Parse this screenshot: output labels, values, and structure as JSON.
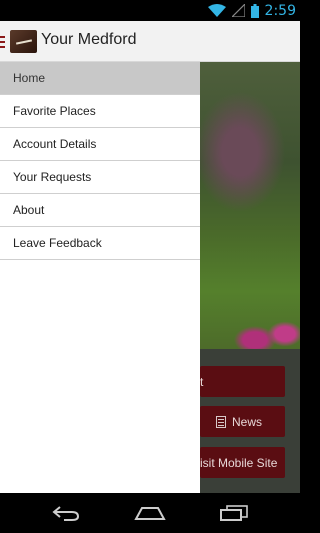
{
  "status_bar": {
    "time": "2:59"
  },
  "app_bar": {
    "title": "Your Medford"
  },
  "drawer": {
    "items": [
      {
        "label": "Home",
        "active": true
      },
      {
        "label": "Favorite Places",
        "active": false
      },
      {
        "label": "Account Details",
        "active": false
      },
      {
        "label": "Your Requests",
        "active": false
      },
      {
        "label": "About",
        "active": false
      },
      {
        "label": "Leave Feedback",
        "active": false
      }
    ]
  },
  "content": {
    "buttons": {
      "first": "t",
      "news": "News",
      "mobile_site": "isit Mobile Site"
    }
  },
  "colors": {
    "accent": "#33b5e5",
    "brand": "#5a0d12",
    "drawer_active": "#c8c8c8"
  }
}
